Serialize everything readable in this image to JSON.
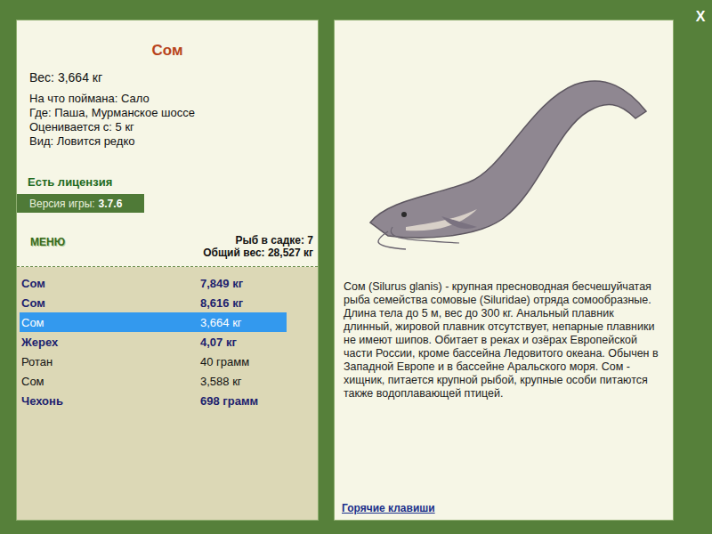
{
  "close": "X",
  "fish": {
    "title": "Сом",
    "weight": "Вес: 3,664 кг",
    "details": [
      "На что поймана: Сало",
      "Где: Паша, Мурманское шоссе",
      "Оценивается с: 5 кг",
      "Вид: Ловится редко"
    ]
  },
  "license": "Есть лицензия",
  "version": {
    "label": "Версия игры:",
    "value": "3.7.6"
  },
  "menu": "МЕНЮ",
  "keepnet": {
    "count": "Рыб в садке: 7",
    "total": "Общий вес: 28,527 кг"
  },
  "catch": [
    {
      "name": "Сом",
      "weight": "7,849 кг",
      "trophy": true,
      "selected": false
    },
    {
      "name": "Сом",
      "weight": "8,616 кг",
      "trophy": true,
      "selected": false
    },
    {
      "name": "Сом",
      "weight": "3,664 кг",
      "trophy": false,
      "selected": true
    },
    {
      "name": "Жерех",
      "weight": "4,07 кг",
      "trophy": true,
      "selected": false
    },
    {
      "name": "Ротан",
      "weight": "40 грамм",
      "trophy": false,
      "selected": false
    },
    {
      "name": "Сом",
      "weight": "3,588 кг",
      "trophy": false,
      "selected": false
    },
    {
      "name": "Чехонь",
      "weight": "698 грамм",
      "trophy": true,
      "selected": false
    }
  ],
  "description": "Сом (Silurus glanis) - крупная пресноводная бесчешуйчатая рыба семейства сомовые (Siluridae) отряда сомообразные. Длина тела до 5 м, вес до 300 кг. Анальный плавник длинный, жировой плавник отсутствует, непарные плавники не имеют шипов. Обитает в реках и озёрах Европейской части России, кроме бассейна Ледовитого океана. Обычен в Западной Европе и в бассейне Аральского моря. Сом - хищник, питается крупной рыбой, крупные особи питаются также водоплавающей птицей.",
  "hotkeys": "Горячие клавиши"
}
